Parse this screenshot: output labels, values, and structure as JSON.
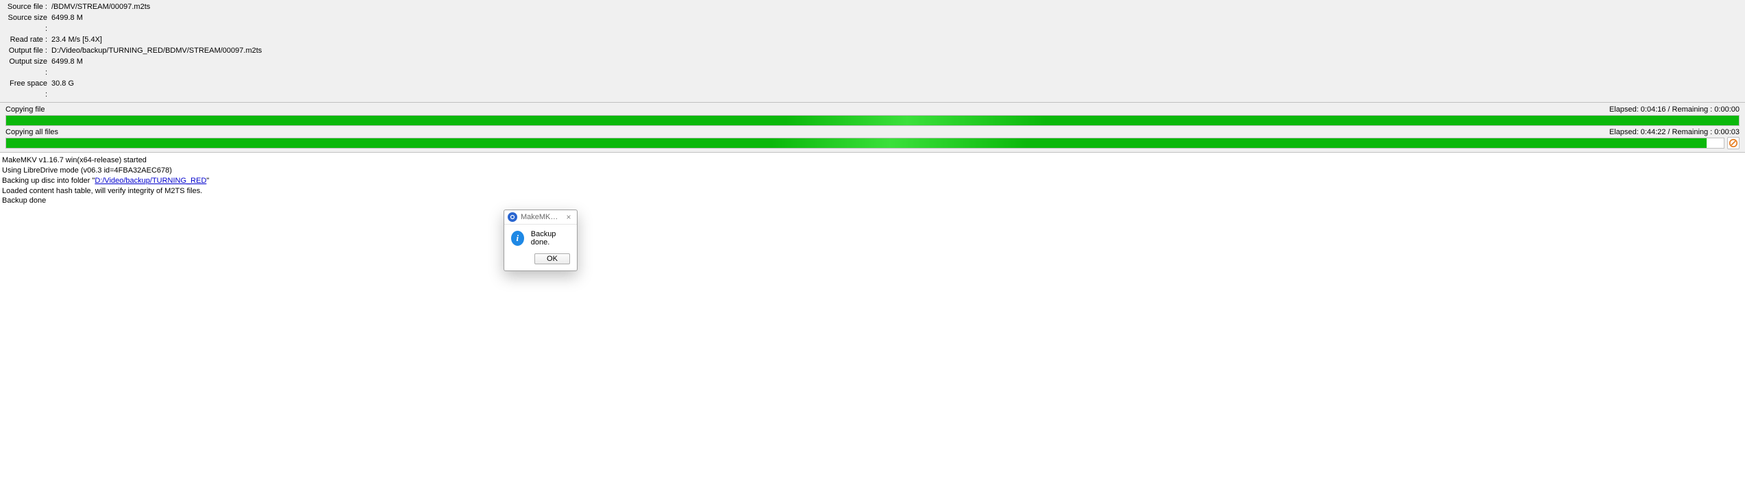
{
  "info": {
    "source_file_label": "Source file :",
    "source_file": "/BDMV/STREAM/00097.m2ts",
    "source_size_label": "Source size :",
    "source_size": "6499.8 M",
    "read_rate_label": "Read rate :",
    "read_rate": "23.4 M/s [5.4X]",
    "output_file_label": "Output file :",
    "output_file": "D:/Video/backup/TURNING_RED/BDMV/STREAM/00097.m2ts",
    "output_size_label": "Output size :",
    "output_size": "6499.8 M",
    "free_space_label": "Free space :",
    "free_space": "30.8 G"
  },
  "progress": {
    "file": {
      "label": "Copying file",
      "timing": "Elapsed: 0:04:16 / Remaining : 0:00:00",
      "percent": 100
    },
    "all": {
      "label": "Copying all files",
      "timing": "Elapsed: 0:44:22 / Remaining : 0:00:03",
      "percent": 99
    },
    "cancel_icon": "cancel"
  },
  "log": {
    "line1": "MakeMKV v1.16.7 win(x64-release) started",
    "line2": "Using LibreDrive mode (v06.3 id=4FBA32AEC678)",
    "line3_pre": "Backing up disc into folder \"",
    "line3_link": "D:/Video/backup/TURNING_RED",
    "line3_post": "\"",
    "line4": "Loaded content hash table, will verify integrity of M2TS files.",
    "line5": "Backup done"
  },
  "dialog": {
    "title": "MakeMKV BETA po…",
    "message": "Backup done.",
    "ok": "OK"
  }
}
